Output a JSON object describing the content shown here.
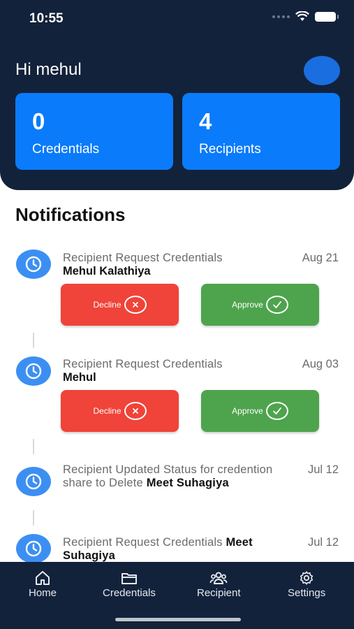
{
  "status_bar": {
    "time": "10:55"
  },
  "header": {
    "greeting": "Hi mehul",
    "cards": {
      "credentials": {
        "count": "0",
        "label": "Credentials"
      },
      "recipients": {
        "count": "4",
        "label": "Recipients"
      }
    }
  },
  "notifications": {
    "title": "Notifications",
    "items": [
      {
        "title": "Recipient Request Credentials",
        "name": "Mehul Kalathiya",
        "date": "Aug 21",
        "decline": "Decline",
        "approve": "Approve"
      },
      {
        "title": "Recipient Request Credentials",
        "name": "Mehul",
        "date": "Aug 03",
        "decline": "Decline",
        "approve": "Approve"
      },
      {
        "title": "Recipient Updated Status for credention share to Delete",
        "name": "Meet Suhagiya",
        "date": "Jul 12"
      },
      {
        "title": "Recipient Request Credentials",
        "name": "Meet Suhagiya",
        "date": "Jul 12"
      }
    ]
  },
  "bottom_nav": {
    "items": [
      {
        "label": "Home",
        "icon": "home-icon"
      },
      {
        "label": "Credentials",
        "icon": "folder-icon"
      },
      {
        "label": "Recipient",
        "icon": "group-icon"
      },
      {
        "label": "Settings",
        "icon": "gear-icon"
      }
    ]
  },
  "colors": {
    "header_bg": "#13223b",
    "card_blue": "#0a7bfa",
    "decline_red": "#f04339",
    "approve_green": "#4ea44c",
    "clock_blue": "#3c8ff2"
  }
}
